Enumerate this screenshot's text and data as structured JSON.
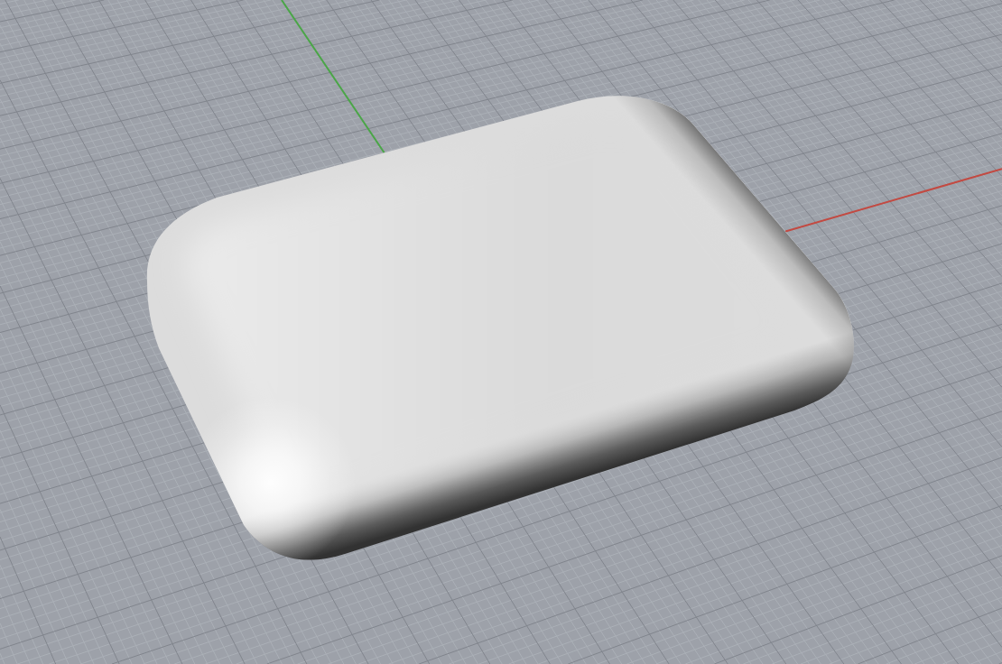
{
  "viewport": {
    "grid": {
      "shown": true
    },
    "axes": [
      {
        "kind": "x",
        "color": "#c34a42"
      },
      {
        "kind": "y",
        "color": "#4aa647"
      }
    ],
    "objects": [
      {
        "kind": "rounded-slab"
      }
    ]
  }
}
